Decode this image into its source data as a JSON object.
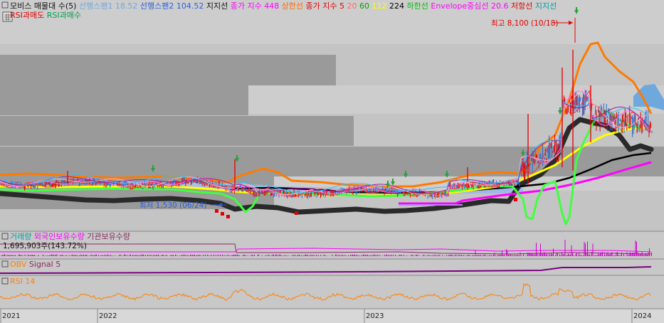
{
  "colors": {
    "background": "#c4c4c4",
    "panel_light": "#cfcfcf",
    "band_gray": "#9a9a9a",
    "candle_up": "#e00000",
    "candle_down": "#2a6ad0",
    "ma5": "#e8e800",
    "ma20": "#e60000",
    "ma60": "#00c000",
    "ma112": "#ffff00",
    "ma224": "#000000",
    "envelope_low": "#ff00ff",
    "envelope_high": "#ff8a00",
    "span1": "#6fa8dc",
    "span2": "#2b5fd9",
    "support": "#00b050",
    "volume": "#cc00cc",
    "foreign": "#ff00ff",
    "institution": "#8a2c60",
    "obv": "#7a0080",
    "rsi": "#ff8000"
  },
  "main_legend": [
    {
      "text": "모비스 매물대 수(5)",
      "color": "#111111"
    },
    {
      "text": "선행스팬1 18.52",
      "color": "#6fa8dc"
    },
    {
      "text": "선행스팬2 104.52",
      "color": "#2b5fd9"
    },
    {
      "text": "지지선",
      "color": "#111111"
    },
    {
      "text": "종가 지수 448",
      "color": "#ff00ff"
    },
    {
      "text": "상한선",
      "color": "#ff6a00"
    },
    {
      "text": "종가 지수 5",
      "color": "#e60000"
    },
    {
      "text": "20",
      "color": "#ff6a6a"
    },
    {
      "text": "60",
      "color": "#00a000"
    },
    {
      "text": "112",
      "color": "#ffff00"
    },
    {
      "text": "224",
      "color": "#000000"
    },
    {
      "text": "하한선",
      "color": "#00c000"
    },
    {
      "text": "Envelope중심선 20.6",
      "color": "#ff00ff"
    },
    {
      "text": "저항선",
      "color": "#e60000"
    },
    {
      "text": "지지선",
      "color": "#00a0a0"
    }
  ],
  "legend_row2": [
    {
      "text": "RSI과매도",
      "color": "#e60000"
    },
    {
      "text": "RSI과매수",
      "color": "#00a050"
    }
  ],
  "annotations": {
    "high": "최고 8,100 (10/18)",
    "low": "최저 1,530 (06/24)"
  },
  "volume_legend": [
    {
      "text": "거래량",
      "color": "#00a0a0"
    },
    {
      "text": "외국인보유수량",
      "color": "#ff00ff"
    },
    {
      "text": "기관보유수량",
      "color": "#8a2c60"
    }
  ],
  "volume_value": "1,695,903주(143.72%)",
  "obv_legend": [
    {
      "text": "OBV",
      "color": "#ff8000"
    },
    {
      "text": "Signal 5",
      "color": "#8a2c60"
    }
  ],
  "rsi_legend": [
    {
      "text": "RSI 14",
      "color": "#ff8000"
    }
  ],
  "x_axis_labels": [
    "2021",
    "2022",
    "2023",
    "2024"
  ]
}
